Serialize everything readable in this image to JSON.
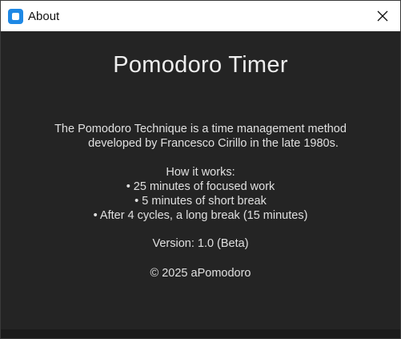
{
  "window": {
    "title": "About",
    "icon": "app-icon",
    "close_icon": "close-icon"
  },
  "about": {
    "app_name": "Pomodoro Timer",
    "description_line1": "The Pomodoro Technique is a time management method",
    "description_line2": "developed by Francesco Cirillo in the late 1980s.",
    "how_heading": "How it works:",
    "how_items": [
      "• 25 minutes of focused work",
      "• 5 minutes of short break",
      "• After 4 cycles, a long break (15 minutes)"
    ],
    "version": "Version: 1.0 (Beta)",
    "copyright": "© 2025 aPomodoro"
  },
  "colors": {
    "background": "#242424",
    "titlebar": "#ffffff",
    "text": "#e0e0e0",
    "accent": "#1e88e5"
  }
}
